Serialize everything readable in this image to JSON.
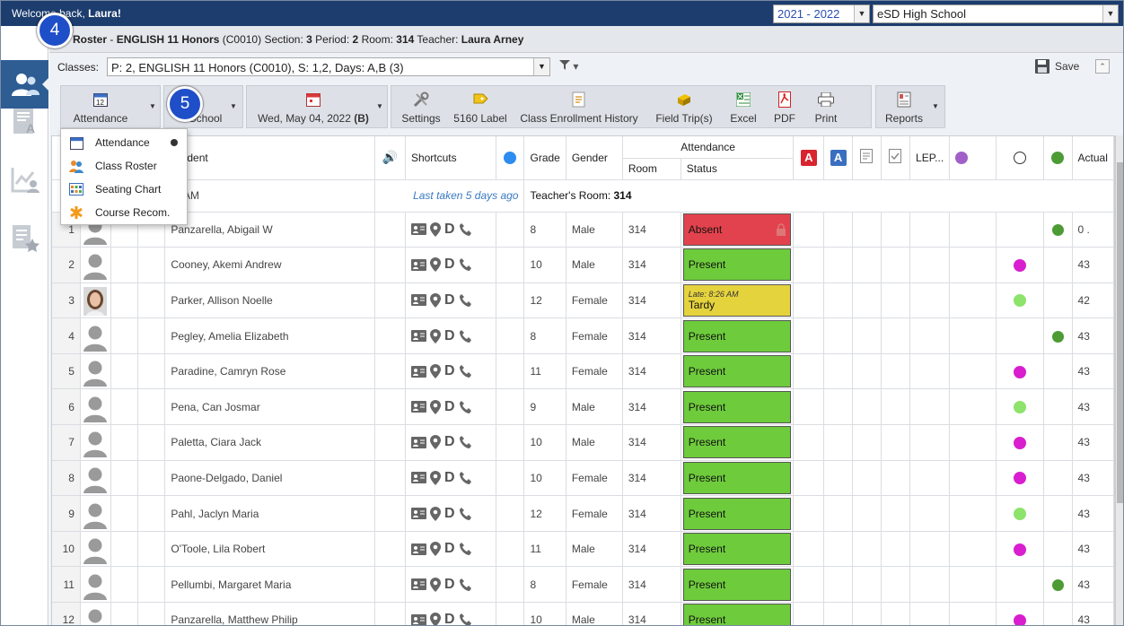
{
  "topbar": {
    "welcome_prefix": "Welcome back, ",
    "welcome_name": "Laura!",
    "year": "2021 - 2022",
    "school": "eSD High School"
  },
  "title": {
    "app": "Roster",
    "course": "ENGLISH 11 Honors",
    "code": "(C0010)",
    "section_label": "Section:",
    "section": "3",
    "period_label": "Period:",
    "period": "2",
    "room_label": "Room:",
    "room": "314",
    "teacher_label": "Teacher:",
    "teacher": "Laura Arney"
  },
  "classes": {
    "label": "Classes:",
    "value": "P: 2, ENGLISH 11 Honors (C0010), S: 1,2, Days: A,B (3)"
  },
  "save_label": "Save",
  "toolbar": {
    "attendance": "Attendance",
    "school": "School",
    "date": "Wed, May 04, 2022",
    "date_day": "(B)",
    "settings": "Settings",
    "label5160": "5160 Label",
    "enrollment_history": "Class Enrollment History",
    "field_trips": "Field Trip(s)",
    "excel": "Excel",
    "pdf": "PDF",
    "print": "Print",
    "reports": "Reports"
  },
  "menu": {
    "items": [
      "Attendance",
      "Class Roster",
      "Seating Chart",
      "Course Recom."
    ]
  },
  "callouts": {
    "c4": "4",
    "c5": "5"
  },
  "table": {
    "headers": {
      "student": "Student",
      "shortcuts": "Shortcuts",
      "grade": "Grade",
      "gender": "Gender",
      "attendance": "Attendance",
      "room": "Room",
      "status": "Status",
      "lep": "LEP...",
      "actual": "Actual"
    },
    "info_row": {
      "time": "8:38 AM",
      "last_taken": "Last taken 5 days ago",
      "teachers_room_label": "Teacher's Room:",
      "teachers_room": "314"
    },
    "rows": [
      {
        "num": "1",
        "name": "Panzarella, Abigail W",
        "grade": "8",
        "gender": "Male",
        "room": "314",
        "status": "Absent",
        "late": "",
        "dot": "",
        "dot2": "green",
        "actual": "0 ."
      },
      {
        "num": "2",
        "name": "Cooney, Akemi Andrew",
        "grade": "10",
        "gender": "Male",
        "room": "314",
        "status": "Present",
        "late": "",
        "dot": "magenta",
        "dot2": "",
        "actual": "43"
      },
      {
        "num": "3",
        "name": "Parker, Allison Noelle",
        "grade": "12",
        "gender": "Female",
        "room": "314",
        "status": "Tardy",
        "late": "Late: 8:26 AM",
        "dot": "lime",
        "dot2": "",
        "actual": "42"
      },
      {
        "num": "4",
        "name": "Pegley, Amelia Elizabeth",
        "grade": "8",
        "gender": "Female",
        "room": "314",
        "status": "Present",
        "late": "",
        "dot": "",
        "dot2": "green",
        "actual": "43"
      },
      {
        "num": "5",
        "name": "Paradine, Camryn Rose",
        "grade": "11",
        "gender": "Female",
        "room": "314",
        "status": "Present",
        "late": "",
        "dot": "magenta",
        "dot2": "",
        "actual": "43"
      },
      {
        "num": "6",
        "name": "Pena, Can Josmar",
        "grade": "9",
        "gender": "Male",
        "room": "314",
        "status": "Present",
        "late": "",
        "dot": "lime",
        "dot2": "",
        "actual": "43"
      },
      {
        "num": "7",
        "name": "Paletta, Ciara Jack",
        "grade": "10",
        "gender": "Male",
        "room": "314",
        "status": "Present",
        "late": "",
        "dot": "magenta",
        "dot2": "",
        "actual": "43"
      },
      {
        "num": "8",
        "name": "Paone-Delgado, Daniel",
        "grade": "10",
        "gender": "Female",
        "room": "314",
        "status": "Present",
        "late": "",
        "dot": "magenta",
        "dot2": "",
        "actual": "43"
      },
      {
        "num": "9",
        "name": "Pahl, Jaclyn Maria",
        "grade": "12",
        "gender": "Female",
        "room": "314",
        "status": "Present",
        "late": "",
        "dot": "lime",
        "dot2": "",
        "actual": "43"
      },
      {
        "num": "10",
        "name": "O'Toole, Lila Robert",
        "grade": "11",
        "gender": "Male",
        "room": "314",
        "status": "Present",
        "late": "",
        "dot": "magenta",
        "dot2": "",
        "actual": "43"
      },
      {
        "num": "11",
        "name": "Pellumbi, Margaret Maria",
        "grade": "8",
        "gender": "Female",
        "room": "314",
        "status": "Present",
        "late": "",
        "dot": "",
        "dot2": "green",
        "actual": "43"
      },
      {
        "num": "12",
        "name": "Panzarella, Matthew Philip",
        "grade": "10",
        "gender": "Male",
        "room": "314",
        "status": "Present",
        "late": "",
        "dot": "magenta",
        "dot2": "",
        "actual": "43"
      }
    ]
  },
  "colors": {
    "topbar": "#1c3d6e",
    "present": "#6ecb3c",
    "absent": "#e2424d",
    "tardy": "#e5d33e",
    "magenta": "#d91ecf",
    "lime": "#8de36b",
    "green": "#4c9b35",
    "callout": "#1f4fc8"
  }
}
